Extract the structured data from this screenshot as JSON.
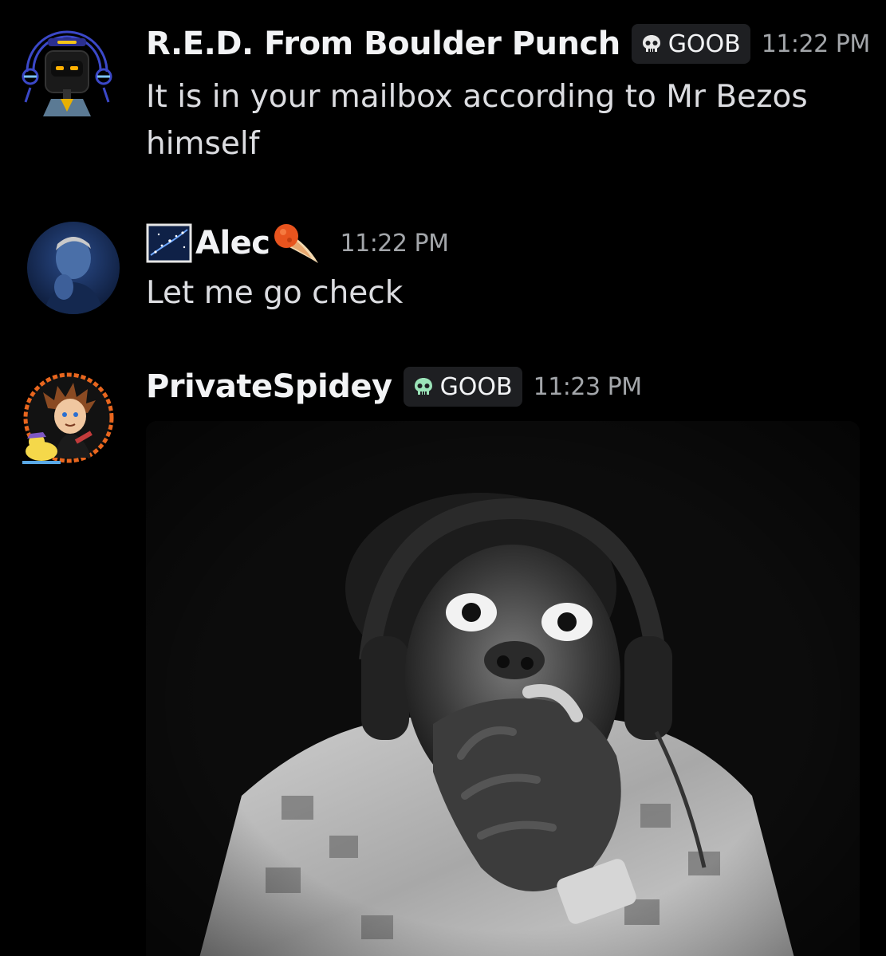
{
  "messages": [
    {
      "author": "R.E.D. From Boulder Punch",
      "tag": "GOOB",
      "timestamp": "11:22 PM",
      "text": "It is in your mailbox according to Mr Bezos himself"
    },
    {
      "author": "Alec",
      "timestamp": "11:22 PM",
      "text": "Let me go check"
    },
    {
      "author": "PrivateSpidey",
      "tag": "GOOB",
      "timestamp": "11:23 PM"
    }
  ],
  "colors": {
    "background": "#000000",
    "username": "#f2f3f5",
    "message_text": "#dcdde1",
    "timestamp": "#a3a6aa",
    "tag_background": "#1e1f22",
    "tag_icon_red": "#e8e8e8",
    "tag_icon_spidey": "#9be3b8"
  },
  "icons": {
    "tag_icon": "skull-icon",
    "alec_leading_icon": "starry-night-icon",
    "alec_trailing_icon": "comet-icon"
  }
}
